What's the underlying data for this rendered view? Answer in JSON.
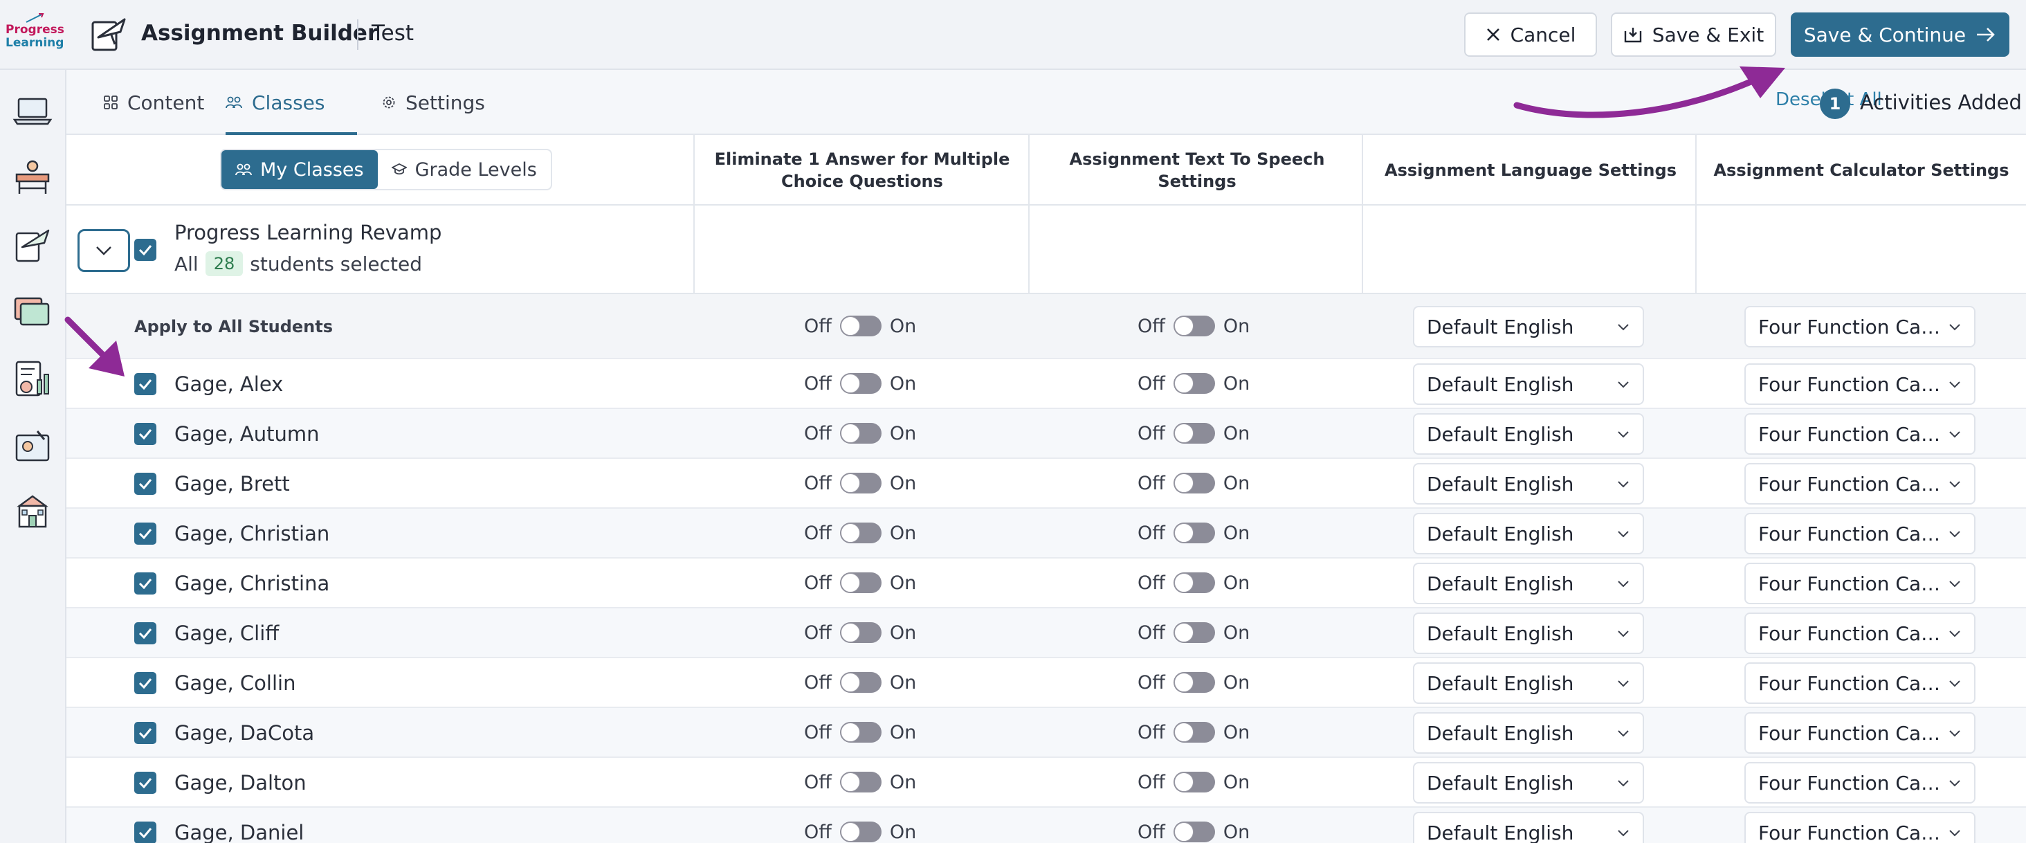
{
  "app": {
    "logo_line1": "Progress",
    "logo_line2": "Learning",
    "title": "Assignment Builder",
    "assignment_name": "Test"
  },
  "header_buttons": {
    "cancel": "Cancel",
    "save_exit": "Save & Exit",
    "save_continue": "Save & Continue"
  },
  "tabs": [
    {
      "label": "Content",
      "icon": "grid-icon"
    },
    {
      "label": "Classes",
      "icon": "group-icon"
    },
    {
      "label": "Settings",
      "icon": "gear-icon"
    }
  ],
  "deselect_all": "Deselect All",
  "activities": {
    "count": "1",
    "label": "Activities Added"
  },
  "segmented": {
    "my_classes": "My Classes",
    "grade_levels": "Grade Levels"
  },
  "columns": {
    "eliminate": "Eliminate 1 Answer for Multiple Choice Questions",
    "tts": "Assignment Text To Speech Settings",
    "language": "Assignment Language Settings",
    "calculator": "Assignment Calculator Settings"
  },
  "class": {
    "name": "Progress Learning Revamp",
    "sub_prefix": "All",
    "count": "28",
    "sub_suffix": "students selected"
  },
  "apply_all_label": "Apply to All Students",
  "toggle_labels": {
    "off": "Off",
    "on": "On"
  },
  "defaults": {
    "language": "Default English",
    "calculator": "Four Function Cal..."
  },
  "students": [
    "Gage, Alex",
    "Gage, Autumn",
    "Gage, Brett",
    "Gage, Christian",
    "Gage, Christina",
    "Gage, Cliff",
    "Gage, Collin",
    "Gage, DaCota",
    "Gage, Dalton",
    "Gage, Daniel"
  ],
  "colors": {
    "primary": "#2d6c8f",
    "annotation_arrow": "#8e2a96",
    "count_pill_bg": "#dff3e6"
  }
}
